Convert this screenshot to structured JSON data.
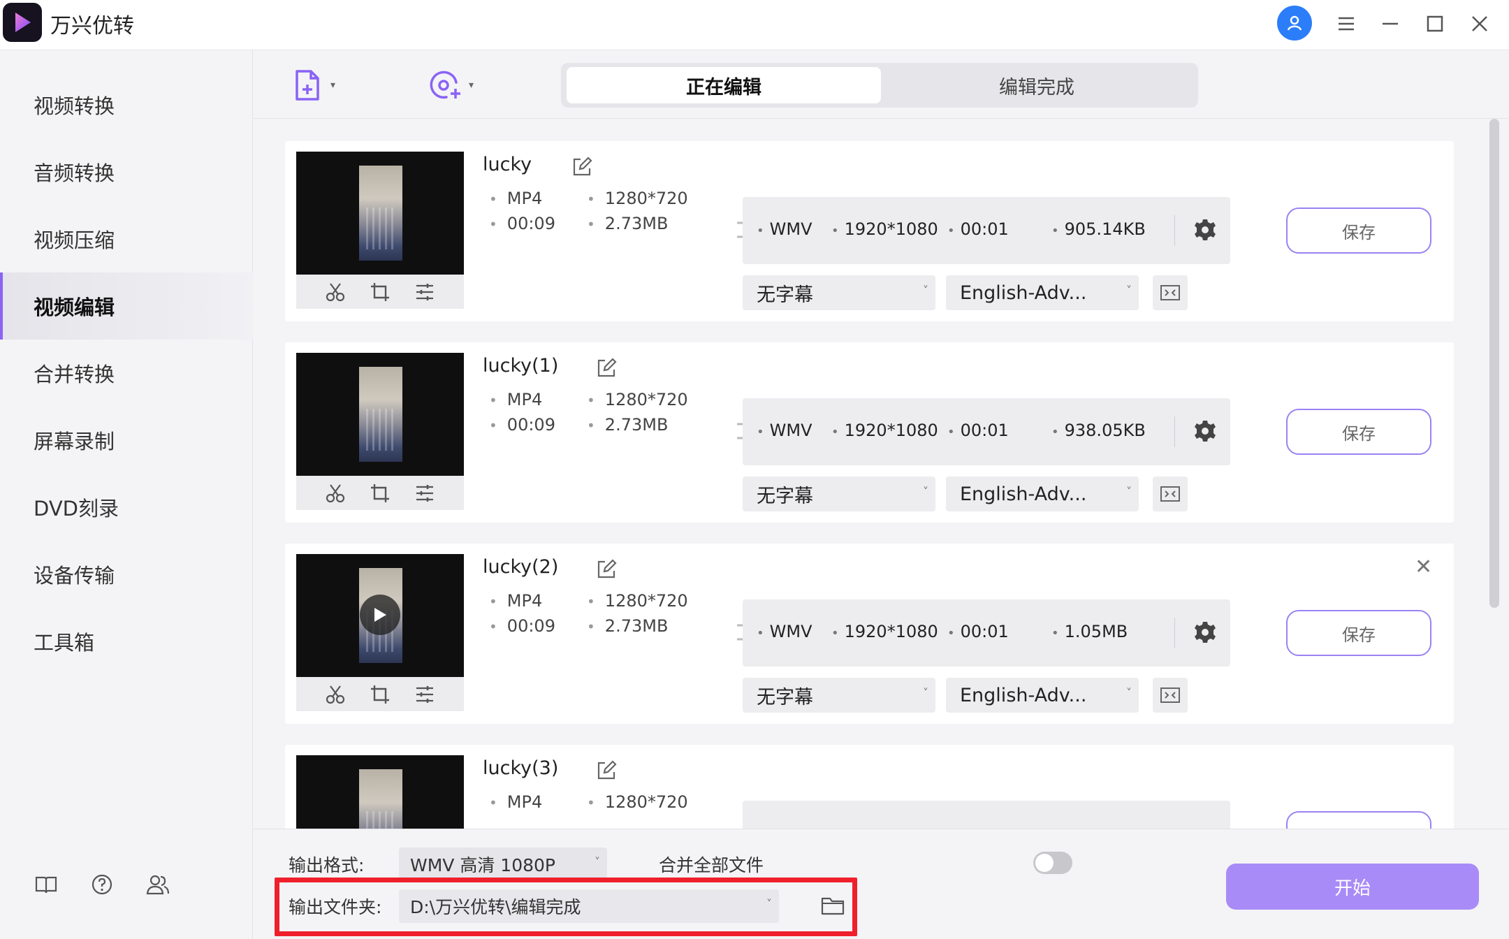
{
  "app": {
    "title": "万兴优转"
  },
  "sidebar": {
    "items": [
      {
        "label": "视频转换"
      },
      {
        "label": "音频转换"
      },
      {
        "label": "视频压缩"
      },
      {
        "label": "视频编辑",
        "active": true
      },
      {
        "label": "合并转换"
      },
      {
        "label": "屏幕录制"
      },
      {
        "label": "DVD刻录"
      },
      {
        "label": "设备传输"
      },
      {
        "label": "工具箱"
      }
    ],
    "footer_icons": [
      "book-icon",
      "help-icon",
      "users-icon"
    ]
  },
  "toolbar": {
    "add_file_icon": "add-file-icon",
    "add_media_icon": "add-media-icon"
  },
  "tabs": [
    {
      "label": "正在编辑",
      "active": true
    },
    {
      "label": "编辑完成",
      "active": false
    }
  ],
  "files": [
    {
      "name": "lucky",
      "src_format": "MP4",
      "src_duration": "00:09",
      "src_resolution": "1280*720",
      "src_size": "2.73MB",
      "out_format": "WMV",
      "out_resolution": "1920*1080",
      "out_duration": "00:01",
      "out_size": "905.14KB",
      "subtitle": "无字幕",
      "audio": "English-Adv...",
      "save_label": "保存"
    },
    {
      "name": "lucky(1)",
      "src_format": "MP4",
      "src_duration": "00:09",
      "src_resolution": "1280*720",
      "src_size": "2.73MB",
      "out_format": "WMV",
      "out_resolution": "1920*1080",
      "out_duration": "00:01",
      "out_size": "938.05KB",
      "subtitle": "无字幕",
      "audio": "English-Adv...",
      "save_label": "保存"
    },
    {
      "name": "lucky(2)",
      "src_format": "MP4",
      "src_duration": "00:09",
      "src_resolution": "1280*720",
      "src_size": "2.73MB",
      "out_format": "WMV",
      "out_resolution": "1920*1080",
      "out_duration": "00:01",
      "out_size": "1.05MB",
      "subtitle": "无字幕",
      "audio": "English-Adv...",
      "save_label": "保存"
    },
    {
      "name": "lucky(3)",
      "src_format": "MP4",
      "src_resolution": "1280*720"
    }
  ],
  "bottom": {
    "output_format_label": "输出格式:",
    "output_format_value": "WMV 高清 1080P",
    "merge_label": "合并全部文件",
    "merge_enabled": false,
    "output_folder_label": "输出文件夹:",
    "output_folder_value": "D:\\万兴优转\\编辑完成",
    "start_label": "开始"
  },
  "colors": {
    "accent": "#8a63f5",
    "start_button": "#a98bf7",
    "highlight_box": "#ef1f2b",
    "user_avatar": "#2b7dfa"
  }
}
